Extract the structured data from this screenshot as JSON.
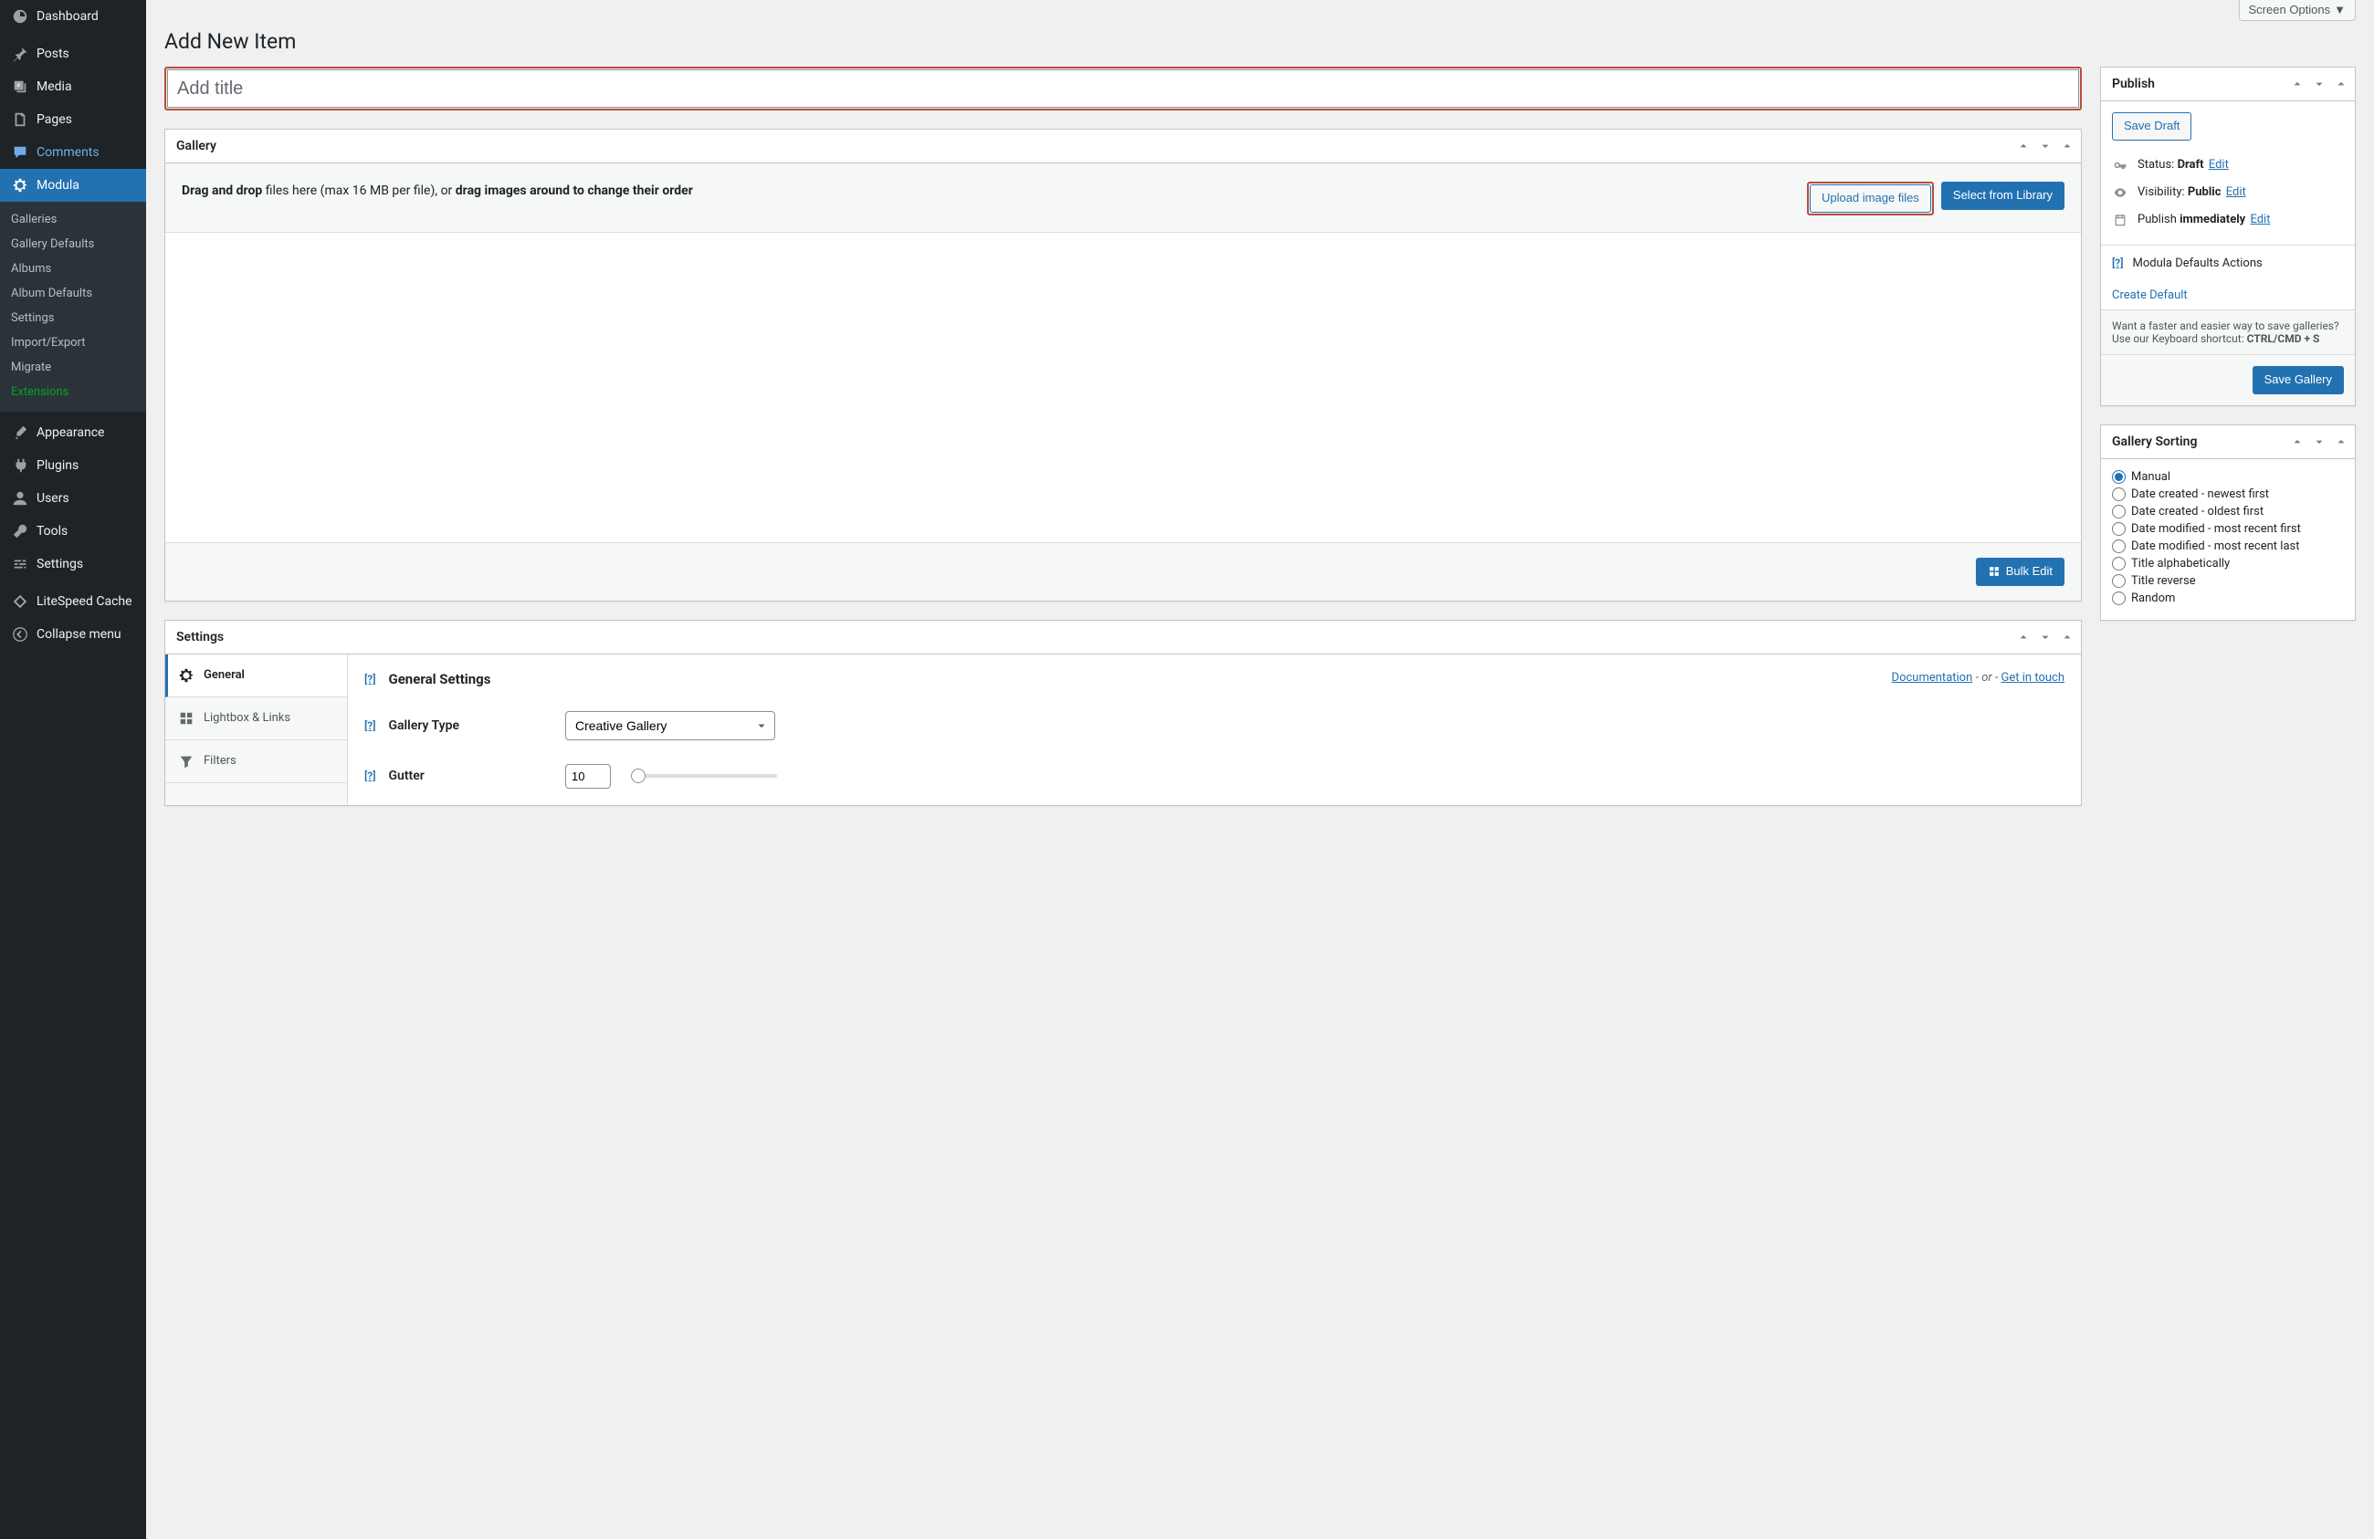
{
  "screen_options_label": "Screen Options",
  "page_title": "Add New Item",
  "title_placeholder": "Add title",
  "sidebar": {
    "items": [
      {
        "label": "Dashboard",
        "icon": "dashboard"
      },
      {
        "label": "Posts",
        "icon": "pin"
      },
      {
        "label": "Media",
        "icon": "media"
      },
      {
        "label": "Pages",
        "icon": "page"
      },
      {
        "label": "Comments",
        "icon": "comment",
        "variant": "comments"
      },
      {
        "label": "Modula",
        "icon": "gear",
        "current": true
      }
    ],
    "modula_submenu": [
      "Galleries",
      "Gallery Defaults",
      "Albums",
      "Album Defaults",
      "Settings",
      "Import/Export",
      "Migrate",
      "Extensions"
    ],
    "extensions_green": true,
    "items_after": [
      {
        "label": "Appearance",
        "icon": "brush"
      },
      {
        "label": "Plugins",
        "icon": "plug"
      },
      {
        "label": "Users",
        "icon": "user"
      },
      {
        "label": "Tools",
        "icon": "wrench"
      },
      {
        "label": "Settings",
        "icon": "sliders"
      }
    ],
    "items_misc": [
      {
        "label": "LiteSpeed Cache",
        "icon": "diamond"
      },
      {
        "label": "Collapse menu",
        "icon": "collapse"
      }
    ]
  },
  "gallery": {
    "heading": "Gallery",
    "drop_text_prefix": "Drag and drop",
    "drop_text_mid": " files here (max 16 MB per file), or ",
    "drop_text_bold2": "drag images around to change their order",
    "upload_btn": "Upload image files",
    "library_btn": "Select from Library",
    "bulk_edit_btn": "Bulk Edit"
  },
  "settings": {
    "heading": "Settings",
    "tabs": [
      "General",
      "Lightbox & Links",
      "Filters"
    ],
    "active_tab": 0,
    "panel_title": "General Settings",
    "doc_link": "Documentation",
    "or_text": " - or - ",
    "contact_link": "Get in touch",
    "type_label": "Gallery Type",
    "type_value": "Creative Gallery",
    "gutter_label": "Gutter",
    "gutter_value": "10",
    "help_marker": "[?]"
  },
  "publish": {
    "heading": "Publish",
    "save_draft": "Save Draft",
    "status_label": "Status:",
    "status_value": "Draft",
    "visibility_label": "Visibility:",
    "visibility_value": "Public",
    "publish_label": "Publish",
    "publish_value": "immediately",
    "edit_label": "Edit",
    "defaults_label": "Modula Defaults Actions",
    "create_default": "Create Default",
    "tip_text": "Want a faster and easier way to save galleries? Use our Keyboard shortcut: ",
    "tip_shortcut": "CTRL/CMD + S",
    "save_gallery": "Save Gallery"
  },
  "sorting": {
    "heading": "Gallery Sorting",
    "options": [
      "Manual",
      "Date created - newest first",
      "Date created - oldest first",
      "Date modified - most recent first",
      "Date modified - most recent last",
      "Title alphabetically",
      "Title reverse",
      "Random"
    ],
    "selected": 0
  }
}
